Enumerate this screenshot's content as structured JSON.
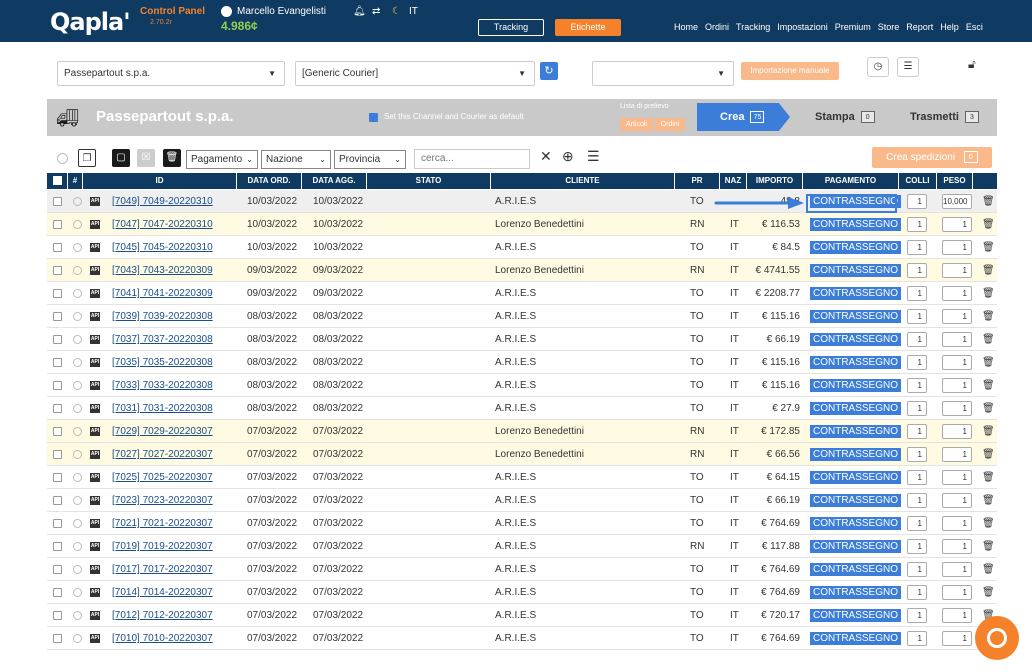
{
  "topbar": {
    "logo": "Qapla'",
    "control_panel": "Control Panel",
    "version": "2.70.2r",
    "user": "Marcello Evangelisti",
    "credit": "4.986¢",
    "lang": "IT",
    "tracking_label": "Tracking",
    "etichette_label": "Etichette",
    "nav": [
      "Home",
      "Ordini",
      "Tracking",
      "Impostazioni",
      "Premium",
      "Store",
      "Report",
      "Help",
      "Esci"
    ]
  },
  "filters": {
    "channel_value": "Passepartout s.p.a.",
    "courier_value": "[Generic Courier]",
    "third_value": "",
    "import_label": "Importazione manuale"
  },
  "channel_header": {
    "title": "Passepartout s.p.a.",
    "default_label": "Set this Channel and Courier as default",
    "lista_label": "Lista di prelievo",
    "articoli_label": "Articoli",
    "ordini_label": "Ordini",
    "steps": [
      {
        "label": "Crea",
        "count": "75"
      },
      {
        "label": "Stampa",
        "count": "0"
      },
      {
        "label": "Trasmetti",
        "count": "3"
      }
    ]
  },
  "toolbar": {
    "pagamento": "Pagamento",
    "nazione": "Nazione",
    "provincia": "Provincia",
    "search_placeholder": "cerca...",
    "crea_spedizioni": "Crea spedizioni",
    "crea_count": "0"
  },
  "table": {
    "headers": [
      "ID",
      "DATA ORD.",
      "DATA AGG.",
      "STATO",
      "CLIENTE",
      "PR",
      "NAZ",
      "IMPORTO",
      "PAGAMENTO",
      "COLLI",
      "PESO"
    ],
    "rows": [
      {
        "id": "[7049] 7049-20220310",
        "data_ord": "10/03/2022",
        "data_agg": "10/03/2022",
        "cliente": "A.R.I.E.S",
        "pr": "TO",
        "naz": "",
        "importo": "48.8",
        "pagamento": "CONTRASSEGNO",
        "colli": "1",
        "peso": "10,000",
        "yellow": false
      },
      {
        "id": "[7047] 7047-20220310",
        "data_ord": "10/03/2022",
        "data_agg": "10/03/2022",
        "cliente": "Lorenzo Benedettini",
        "pr": "RN",
        "naz": "IT",
        "importo": "€ 116.53",
        "pagamento": "CONTRASSEGNO",
        "colli": "1",
        "peso": "1",
        "yellow": true
      },
      {
        "id": "[7045] 7045-20220310",
        "data_ord": "10/03/2022",
        "data_agg": "10/03/2022",
        "cliente": "A.R.I.E.S",
        "pr": "TO",
        "naz": "IT",
        "importo": "€ 84.5",
        "pagamento": "CONTRASSEGNO",
        "colli": "1",
        "peso": "1",
        "yellow": false
      },
      {
        "id": "[7043] 7043-20220309",
        "data_ord": "09/03/2022",
        "data_agg": "09/03/2022",
        "cliente": "Lorenzo Benedettini",
        "pr": "RN",
        "naz": "IT",
        "importo": "€ 4741.55",
        "pagamento": "CONTRASSEGNO",
        "colli": "1",
        "peso": "1",
        "yellow": true
      },
      {
        "id": "[7041] 7041-20220309",
        "data_ord": "09/03/2022",
        "data_agg": "09/03/2022",
        "cliente": "A.R.I.E.S",
        "pr": "TO",
        "naz": "IT",
        "importo": "€ 2208.77",
        "pagamento": "CONTRASSEGNO",
        "colli": "1",
        "peso": "1",
        "yellow": false
      },
      {
        "id": "[7039] 7039-20220308",
        "data_ord": "08/03/2022",
        "data_agg": "08/03/2022",
        "cliente": "A.R.I.E.S",
        "pr": "TO",
        "naz": "IT",
        "importo": "€ 115.16",
        "pagamento": "CONTRASSEGNO",
        "colli": "1",
        "peso": "1",
        "yellow": false
      },
      {
        "id": "[7037] 7037-20220308",
        "data_ord": "08/03/2022",
        "data_agg": "08/03/2022",
        "cliente": "A.R.I.E.S",
        "pr": "TO",
        "naz": "IT",
        "importo": "€ 66.19",
        "pagamento": "CONTRASSEGNO",
        "colli": "1",
        "peso": "1",
        "yellow": false
      },
      {
        "id": "[7035] 7035-20220308",
        "data_ord": "08/03/2022",
        "data_agg": "08/03/2022",
        "cliente": "A.R.I.E.S",
        "pr": "TO",
        "naz": "IT",
        "importo": "€ 115.16",
        "pagamento": "CONTRASSEGNO",
        "colli": "1",
        "peso": "1",
        "yellow": false
      },
      {
        "id": "[7033] 7033-20220308",
        "data_ord": "08/03/2022",
        "data_agg": "08/03/2022",
        "cliente": "A.R.I.E.S",
        "pr": "TO",
        "naz": "IT",
        "importo": "€ 115.16",
        "pagamento": "CONTRASSEGNO",
        "colli": "1",
        "peso": "1",
        "yellow": false
      },
      {
        "id": "[7031] 7031-20220308",
        "data_ord": "08/03/2022",
        "data_agg": "08/03/2022",
        "cliente": "A.R.I.E.S",
        "pr": "TO",
        "naz": "IT",
        "importo": "€ 27.9",
        "pagamento": "CONTRASSEGNO",
        "colli": "1",
        "peso": "1",
        "yellow": false
      },
      {
        "id": "[7029] 7029-20220307",
        "data_ord": "07/03/2022",
        "data_agg": "07/03/2022",
        "cliente": "Lorenzo Benedettini",
        "pr": "RN",
        "naz": "IT",
        "importo": "€ 172.85",
        "pagamento": "CONTRASSEGNO",
        "colli": "1",
        "peso": "1",
        "yellow": true
      },
      {
        "id": "[7027] 7027-20220307",
        "data_ord": "07/03/2022",
        "data_agg": "07/03/2022",
        "cliente": "Lorenzo Benedettini",
        "pr": "RN",
        "naz": "IT",
        "importo": "€ 66.56",
        "pagamento": "CONTRASSEGNO",
        "colli": "1",
        "peso": "1",
        "yellow": true
      },
      {
        "id": "[7025] 7025-20220307",
        "data_ord": "07/03/2022",
        "data_agg": "07/03/2022",
        "cliente": "A.R.I.E.S",
        "pr": "TO",
        "naz": "IT",
        "importo": "€ 64.15",
        "pagamento": "CONTRASSEGNO",
        "colli": "1",
        "peso": "1",
        "yellow": false
      },
      {
        "id": "[7023] 7023-20220307",
        "data_ord": "07/03/2022",
        "data_agg": "07/03/2022",
        "cliente": "A.R.I.E.S",
        "pr": "TO",
        "naz": "IT",
        "importo": "€ 66.19",
        "pagamento": "CONTRASSEGNO",
        "colli": "1",
        "peso": "1",
        "yellow": false
      },
      {
        "id": "[7021] 7021-20220307",
        "data_ord": "07/03/2022",
        "data_agg": "07/03/2022",
        "cliente": "A.R.I.E.S",
        "pr": "TO",
        "naz": "IT",
        "importo": "€ 764.69",
        "pagamento": "CONTRASSEGNO",
        "colli": "1",
        "peso": "1",
        "yellow": false
      },
      {
        "id": "[7019] 7019-20220307",
        "data_ord": "07/03/2022",
        "data_agg": "07/03/2022",
        "cliente": "A.R.I.E.S",
        "pr": "RN",
        "naz": "IT",
        "importo": "€ 117.88",
        "pagamento": "CONTRASSEGNO",
        "colli": "1",
        "peso": "1",
        "yellow": false
      },
      {
        "id": "[7017] 7017-20220307",
        "data_ord": "07/03/2022",
        "data_agg": "07/03/2022",
        "cliente": "A.R.I.E.S",
        "pr": "TO",
        "naz": "IT",
        "importo": "€ 764.69",
        "pagamento": "CONTRASSEGNO",
        "colli": "1",
        "peso": "1",
        "yellow": false
      },
      {
        "id": "[7014] 7014-20220307",
        "data_ord": "07/03/2022",
        "data_agg": "07/03/2022",
        "cliente": "A.R.I.E.S",
        "pr": "TO",
        "naz": "IT",
        "importo": "€ 764.69",
        "pagamento": "CONTRASSEGNO",
        "colli": "1",
        "peso": "1",
        "yellow": false
      },
      {
        "id": "[7012] 7012-20220307",
        "data_ord": "07/03/2022",
        "data_agg": "07/03/2022",
        "cliente": "A.R.I.E.S",
        "pr": "TO",
        "naz": "IT",
        "importo": "€ 720.17",
        "pagamento": "CONTRASSEGNO",
        "colli": "1",
        "peso": "1",
        "yellow": false
      },
      {
        "id": "[7010] 7010-20220307",
        "data_ord": "07/03/2022",
        "data_agg": "07/03/2022",
        "cliente": "A.R.I.E.S",
        "pr": "TO",
        "naz": "IT",
        "importo": "€ 764.69",
        "pagamento": "CONTRASSEGNO",
        "colli": "1",
        "peso": "1",
        "yellow": false
      }
    ]
  },
  "colors": {
    "navy": "#0f3a62",
    "accent_blue": "#3b7dd8",
    "orange": "#f5822a",
    "yellow_row": "#fefbe2"
  }
}
